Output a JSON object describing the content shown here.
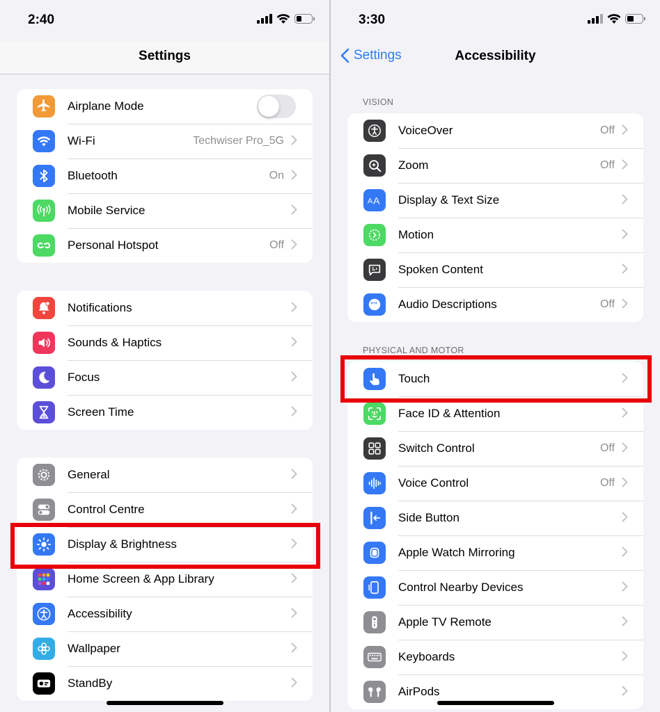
{
  "left": {
    "status_time": "2:40",
    "nav_title": "Settings",
    "groups": [
      {
        "rows": [
          {
            "label": "Airplane Mode",
            "value": "",
            "toggle": true,
            "icon": "airplane-icon",
            "color": "#f19a37"
          },
          {
            "label": "Wi-Fi",
            "value": "Techwiser Pro_5G",
            "icon": "wifi-icon",
            "color": "#3478f6"
          },
          {
            "label": "Bluetooth",
            "value": "On",
            "icon": "bluetooth-icon",
            "color": "#3478f6"
          },
          {
            "label": "Mobile Service",
            "value": "",
            "icon": "antenna-icon",
            "color": "#4cd964"
          },
          {
            "label": "Personal Hotspot",
            "value": "Off",
            "icon": "hotspot-icon",
            "color": "#4cd964"
          }
        ]
      },
      {
        "rows": [
          {
            "label": "Notifications",
            "value": "",
            "icon": "bell-icon",
            "color": "#f1453d"
          },
          {
            "label": "Sounds & Haptics",
            "value": "",
            "icon": "speaker-icon",
            "color": "#f0365a"
          },
          {
            "label": "Focus",
            "value": "",
            "icon": "moon-icon",
            "color": "#5b4fd9"
          },
          {
            "label": "Screen Time",
            "value": "",
            "icon": "hourglass-icon",
            "color": "#5b4fd9"
          }
        ]
      },
      {
        "rows": [
          {
            "label": "General",
            "value": "",
            "icon": "gear-icon",
            "color": "#8e8e93"
          },
          {
            "label": "Control Centre",
            "value": "",
            "icon": "switches-icon",
            "color": "#8e8e93"
          },
          {
            "label": "Display & Brightness",
            "value": "",
            "icon": "sun-icon",
            "color": "#3478f6"
          },
          {
            "label": "Home Screen & App Library",
            "value": "",
            "icon": "app-grid-icon",
            "color": "#5b4fd9"
          },
          {
            "label": "Accessibility",
            "value": "",
            "icon": "accessibility-icon",
            "color": "#3478f6"
          },
          {
            "label": "Wallpaper",
            "value": "",
            "icon": "flower-icon",
            "color": "#32ade6"
          },
          {
            "label": "StandBy",
            "value": "",
            "icon": "standby-icon",
            "color": "#000000"
          }
        ]
      }
    ]
  },
  "right": {
    "status_time": "3:30",
    "back_label": "Settings",
    "nav_title": "Accessibility",
    "sections": [
      {
        "header": "VISION",
        "rows": [
          {
            "label": "VoiceOver",
            "value": "Off",
            "icon": "voiceover-icon",
            "color": "#3a3a3c"
          },
          {
            "label": "Zoom",
            "value": "Off",
            "icon": "zoom-icon",
            "color": "#3a3a3c"
          },
          {
            "label": "Display & Text Size",
            "value": "",
            "icon": "text-size-icon",
            "color": "#3478f6"
          },
          {
            "label": "Motion",
            "value": "",
            "icon": "motion-icon",
            "color": "#4cd964"
          },
          {
            "label": "Spoken Content",
            "value": "",
            "icon": "spoken-content-icon",
            "color": "#3a3a3c"
          },
          {
            "label": "Audio Descriptions",
            "value": "Off",
            "icon": "audio-description-icon",
            "color": "#3478f6"
          }
        ]
      },
      {
        "header": "PHYSICAL AND MOTOR",
        "rows": [
          {
            "label": "Touch",
            "value": "",
            "icon": "hand-pointer-icon",
            "color": "#3478f6"
          },
          {
            "label": "Face ID & Attention",
            "value": "",
            "icon": "face-id-icon",
            "color": "#4cd964"
          },
          {
            "label": "Switch Control",
            "value": "Off",
            "icon": "switch-control-icon",
            "color": "#3a3a3c"
          },
          {
            "label": "Voice Control",
            "value": "Off",
            "icon": "voice-control-icon",
            "color": "#3478f6"
          },
          {
            "label": "Side Button",
            "value": "",
            "icon": "side-button-icon",
            "color": "#3478f6"
          },
          {
            "label": "Apple Watch Mirroring",
            "value": "",
            "icon": "watch-icon",
            "color": "#3478f6"
          },
          {
            "label": "Control Nearby Devices",
            "value": "",
            "icon": "nearby-devices-icon",
            "color": "#3478f6"
          },
          {
            "label": "Apple TV Remote",
            "value": "",
            "icon": "tv-remote-icon",
            "color": "#8e8e93"
          },
          {
            "label": "Keyboards",
            "value": "",
            "icon": "keyboard-icon",
            "color": "#8e8e93"
          },
          {
            "label": "AirPods",
            "value": "",
            "icon": "airpods-icon",
            "color": "#8e8e93"
          }
        ]
      }
    ]
  },
  "highlight_color": "#e8000b"
}
